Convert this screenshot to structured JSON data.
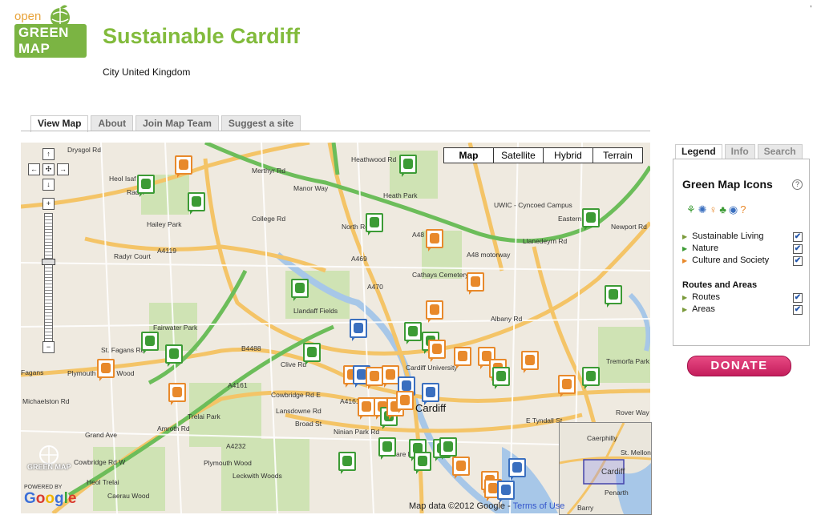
{
  "header": {
    "logo_open": "open",
    "logo_green_map": "GREEN MAP",
    "title": "Sustainable Cardiff",
    "subtitle": "City United Kingdom"
  },
  "tabs": [
    {
      "label": "View Map",
      "active": true
    },
    {
      "label": "About"
    },
    {
      "label": "Join Map Team"
    },
    {
      "label": "Suggest a site"
    }
  ],
  "map": {
    "map_types": [
      "Map",
      "Satellite",
      "Hybrid",
      "Terrain"
    ],
    "selected_type": "Map",
    "copyright": "Map data ©2012 Google -",
    "terms": "Terms of Use",
    "powered_by": "POWERED BY",
    "google": "Google",
    "watermark": "GREEN MAP",
    "places": [
      "Drysgol Rd",
      "Heol Isaf",
      "Radyr",
      "Hailey Park",
      "Radyr Court",
      "Heath Park",
      "Heathwood Rd",
      "Merthyr Rd",
      "Manor Way",
      "College Rd",
      "North Rd",
      "A48",
      "Eastern Ave",
      "A48 motorway",
      "UWIC - Cyncoed Campus",
      "Llanedeyrn Rd",
      "Newport Rd",
      "Cathays Cemetery",
      "A470",
      "A469",
      "Llandaff Fields",
      "Fairwater Park",
      "St. Fagans Rd",
      "Fagans",
      "Plymouth Great Wood",
      "B4488",
      "Clive Rd",
      "A4119",
      "A4161",
      "Albany Rd",
      "A4161",
      "Tremorfa Park",
      "Cardiff University",
      "Cardiff",
      "Cowbridge Rd E",
      "Lansdowne Rd",
      "Trelai Park",
      "Grand Ave",
      "Broad St",
      "Ninian Park Rd",
      "E Tyndall St",
      "Rover Way",
      "Cowbridge Rd W",
      "A4232",
      "Plymouth Wood",
      "Leckwith Woods",
      "Heol Trelai",
      "Caerau Wood",
      "Amroth Rd",
      "Clare Rd",
      "Michaelston Rd",
      "Caerphilly",
      "St. Mellons",
      "Penarth",
      "Barry"
    ],
    "overview_label": "Cardiff"
  },
  "legend": {
    "tabs": [
      "Legend",
      "Info",
      "Search"
    ],
    "heading": "Green Map Icons",
    "categories": [
      {
        "label": "Sustainable Living",
        "checked": true
      },
      {
        "label": "Nature",
        "checked": true
      },
      {
        "label": "Culture and Society",
        "checked": true
      }
    ],
    "routes_heading": "Routes and Areas",
    "routes": [
      {
        "label": "Routes",
        "checked": true
      },
      {
        "label": "Areas",
        "checked": true
      }
    ]
  },
  "donate": "DONATE",
  "colors": {
    "brand_green": "#82bb3c",
    "donate": "#d42a6a",
    "marker_green": "#3c9b35",
    "marker_orange": "#e8892b",
    "marker_blue": "#3a6fbf"
  }
}
